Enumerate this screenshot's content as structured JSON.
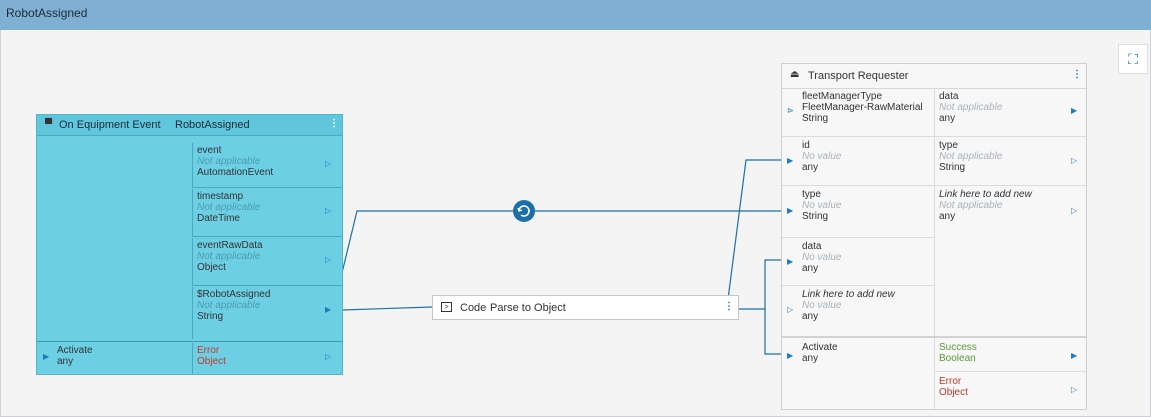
{
  "window": {
    "title": "RobotAssigned"
  },
  "event_node": {
    "title": "On Equipment Event",
    "subtitle": "RobotAssigned",
    "outputs": [
      {
        "name": "event",
        "value": "Not applicable",
        "type": "AutomationEvent"
      },
      {
        "name": "timestamp",
        "value": "Not applicable",
        "type": "DateTime"
      },
      {
        "name": "eventRawData",
        "value": "Not applicable",
        "type": "Object"
      },
      {
        "name": "$RobotAssigned",
        "value": "Not applicable",
        "type": "String"
      }
    ],
    "activate": {
      "name": "Activate",
      "type": "any"
    },
    "error": {
      "name": "Error",
      "type": "Object"
    }
  },
  "code_node": {
    "label": "Code",
    "name": "Parse to Object"
  },
  "transport_node": {
    "title": "Transport Requester",
    "inputs": [
      {
        "name": "fleetManagerType",
        "value": "FleetManager-RawMaterial",
        "type": "String"
      },
      {
        "name": "id",
        "value": "No value",
        "type": "any"
      },
      {
        "name": "type",
        "value": "No value",
        "type": "String"
      },
      {
        "name": "data",
        "value": "No value",
        "type": "any"
      },
      {
        "name": "Link here to add new",
        "value": "No value",
        "type": "any"
      }
    ],
    "outputs": [
      {
        "name": "data",
        "value": "Not applicable",
        "type": "any"
      },
      {
        "name": "type",
        "value": "Not applicable",
        "type": "String"
      },
      {
        "name": "Link here to add new",
        "value": "Not applicable",
        "type": "any"
      }
    ],
    "activate": {
      "name": "Activate",
      "type": "any"
    },
    "success": {
      "name": "Success",
      "type": "Boolean"
    },
    "error": {
      "name": "Error",
      "type": "Object"
    }
  },
  "colors": {
    "title_bar": "#7fb0d4",
    "event_node": "#6ccfe3",
    "wire": "#1c6fa8",
    "accent": "#1c7ec2"
  },
  "icons": {
    "event_node": "monitor-icon",
    "transport_node": "robot-icon",
    "code_node": "terminal-icon",
    "converter": "refresh-icon",
    "fullscreen": "fullscreen-icon"
  }
}
